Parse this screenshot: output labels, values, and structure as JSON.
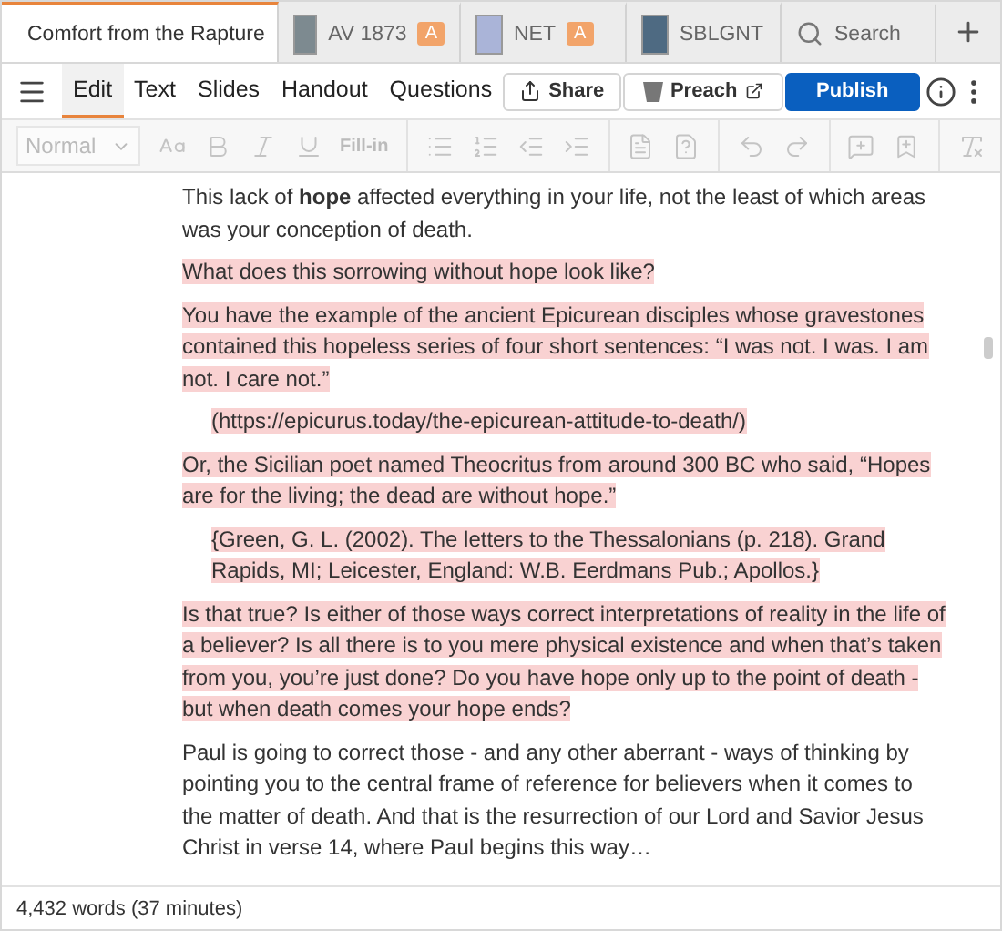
{
  "tabs": [
    {
      "kind": "document",
      "label": "Comfort from the Rapture",
      "selected": true
    },
    {
      "kind": "resource",
      "label": "AV 1873",
      "badge": "A",
      "selected": false
    },
    {
      "kind": "resource",
      "label": "NET",
      "badge": "A",
      "selected": false
    },
    {
      "kind": "resource",
      "label": "SBLGNT",
      "selected": false
    },
    {
      "kind": "search",
      "label": "Search",
      "selected": false
    }
  ],
  "menu": [
    {
      "label": "Edit",
      "selected": true
    },
    {
      "label": "Text",
      "selected": false
    },
    {
      "label": "Slides",
      "selected": false
    },
    {
      "label": "Handout",
      "selected": false
    },
    {
      "label": "Questions",
      "selected": false
    }
  ],
  "actions": {
    "share": "Share",
    "preach": "Preach",
    "publish": "Publish"
  },
  "format_toolbar": {
    "style": "Normal",
    "fill_in": "Fill-in",
    "disabled": true
  },
  "paragraphs": [
    {
      "text": "This lack of **hope** affected everything in your life, not the least of which areas was your conception of death.",
      "highlighted": false,
      "indented": false
    },
    {
      "text": "What does this sorrowing without hope look like?",
      "highlighted": true,
      "indented": false
    },
    {
      "text": "You have the example of the ancient Epicurean disciples whose gravestones contained this hopeless series of four short sentences: “I was not. I was. I am not. I care not.”",
      "highlighted": true,
      "indented": false
    },
    {
      "text": "(https://epicurus.today/the-epicurean-attitude-to-death/)",
      "highlighted": true,
      "indented": true
    },
    {
      "text": "Or, the Sicilian poet named Theocritus from around 300 BC who said, “Hopes are for the living; the dead are without hope.”",
      "highlighted": true,
      "indented": false
    },
    {
      "text": "{Green, G. L. (2002). The letters to the Thessalonians (p. 218). Grand Rapids, MI; Leicester, England: W.B. Eerdmans Pub.; Apollos.}",
      "highlighted": true,
      "indented": true
    },
    {
      "text": "Is that true? Is either of those ways correct interpretations of reality in the life of a believer? Is all there is to you mere physical existence and when that’s taken from you, you’re just done? Do you have hope only up to the point of death - but when death comes your hope ends?",
      "highlighted": true,
      "indented": false
    },
    {
      "text": "Paul is going to correct those - and any other aberrant - ways of thinking by pointing you to the central frame of reference for believers when it comes to the matter of death. And that is the resurrection of our Lord and Savior Jesus Christ in verse 14, where Paul begins this way…",
      "highlighted": false,
      "indented": false
    }
  ],
  "status_bar": "4,432 words (37 minutes)"
}
